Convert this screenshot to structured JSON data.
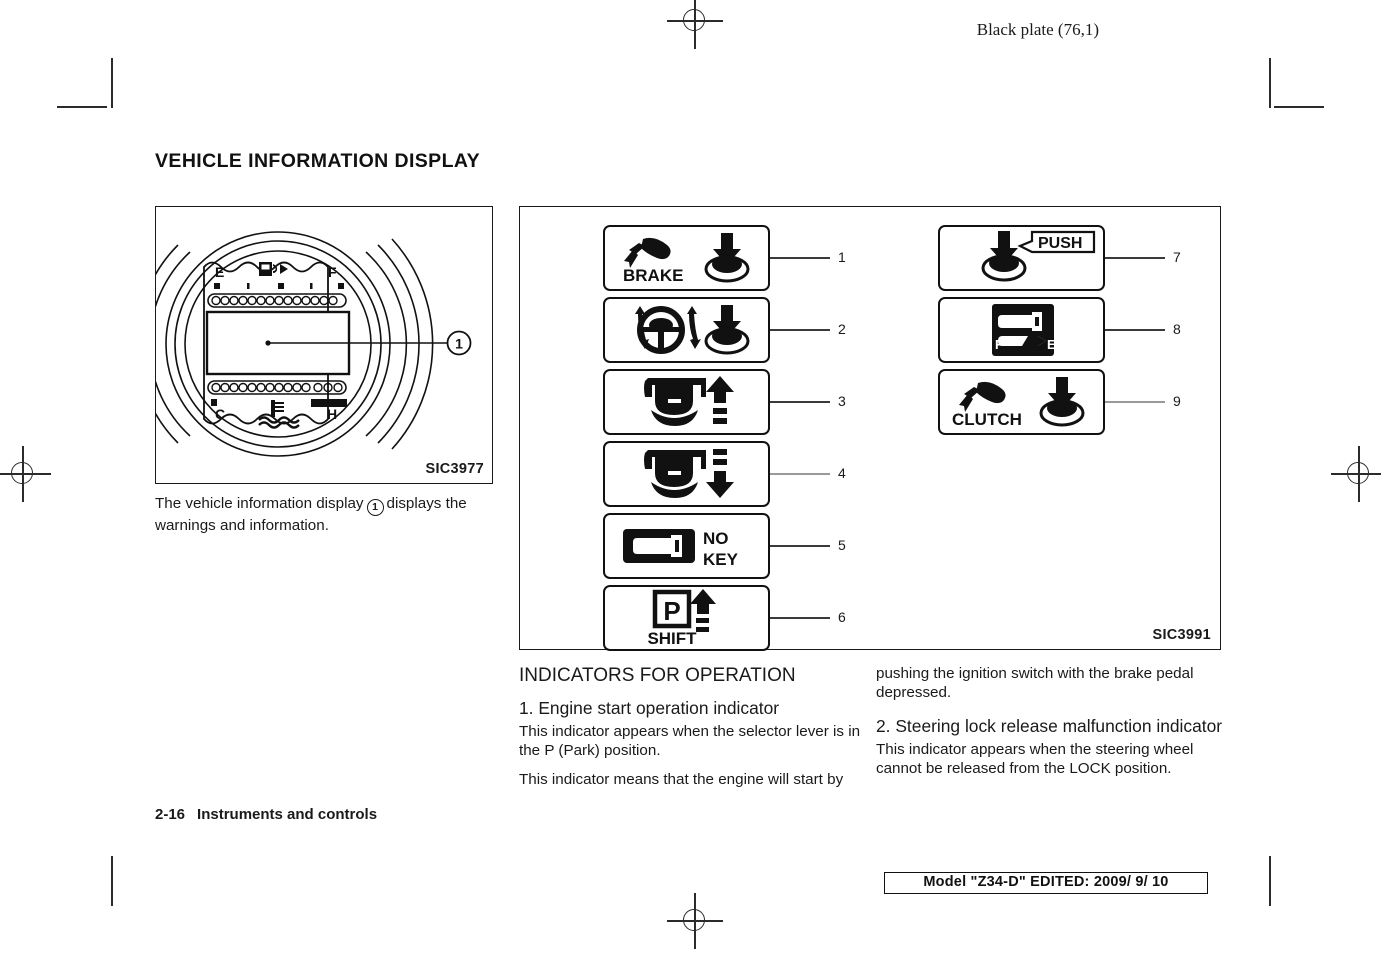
{
  "header": {
    "black_plate": "Black plate (76,1)"
  },
  "section": {
    "title": "VEHICLE INFORMATION DISPLAY"
  },
  "figure_meter": {
    "id": "SIC3977",
    "callout": "1",
    "labels": {
      "fuel_empty": "E",
      "fuel_full": "F",
      "temp_cold": "C",
      "temp_hot": "H",
      "fuel_icon": "fuel-pump-icon",
      "temp_icon": "coolant-temperature-icon"
    }
  },
  "caption_meter": {
    "text_before": "The vehicle information display",
    "callout": "1",
    "text_after": "displays the warnings and information."
  },
  "figure_indicators": {
    "id": "SIC3991",
    "items": [
      {
        "num": "1",
        "icon": "brake-pedal-push-start-icon",
        "text": "BRAKE"
      },
      {
        "num": "2",
        "icon": "steering-wheel-push-start-icon",
        "text": ""
      },
      {
        "num": "3",
        "icon": "shift-lever-up-icon",
        "text": ""
      },
      {
        "num": "4",
        "icon": "shift-lever-down-icon",
        "text": ""
      },
      {
        "num": "5",
        "icon": "no-key-icon",
        "text": "NO KEY"
      },
      {
        "num": "6",
        "icon": "shift-to-park-icon",
        "text": "SHIFT"
      },
      {
        "num": "7",
        "icon": "push-ignition-switch-icon",
        "text": "PUSH"
      },
      {
        "num": "8",
        "icon": "key-battery-low-icon",
        "text": "F E"
      },
      {
        "num": "9",
        "icon": "clutch-pedal-push-start-icon",
        "text": "CLUTCH"
      }
    ],
    "labels": {
      "brake": "BRAKE",
      "no": "NO",
      "key": "KEY",
      "shift": "SHIFT",
      "park": "P",
      "push": "PUSH",
      "clutch": "CLUTCH",
      "batt_f": "F",
      "batt_e": "E"
    }
  },
  "body": {
    "heading": "INDICATORS FOR OPERATION",
    "item1": {
      "heading": "1. Engine start operation indicator",
      "para1": "This indicator appears when the selector lever is in the P (Park) position.",
      "para2": "This indicator means that the engine will start by",
      "para2_cont": "pushing the ignition switch with the brake pedal depressed."
    },
    "item2": {
      "heading": "2. Steering lock release malfunction indicator",
      "para1": "This indicator appears when the steering wheel cannot be released from the LOCK position."
    }
  },
  "footer": {
    "page_number": "2-16",
    "chapter": "Instruments and controls",
    "model_line": "Model \"Z34-D\"  EDITED:  2009/ 9/ 10"
  }
}
